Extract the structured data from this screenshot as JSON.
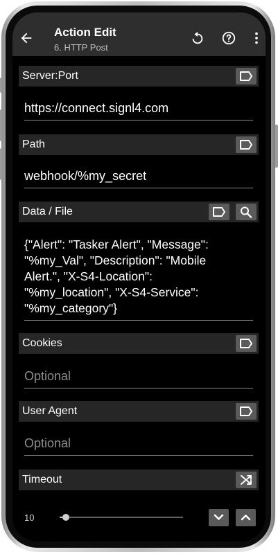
{
  "appbar": {
    "title": "Action Edit",
    "subtitle": "6. HTTP Post",
    "icons": [
      "back-arrow-icon",
      "undo-icon",
      "help-icon",
      "more-vert-icon"
    ]
  },
  "sections": {
    "server_port": {
      "label": "Server:Port",
      "value": "https://connect.signl4.com"
    },
    "path": {
      "label": "Path",
      "value": "webhook/%my_secret"
    },
    "data_file": {
      "label": "Data / File",
      "value": "{\"Alert\": \"Tasker Alert\", \"Message\":\n\"%my_Val\", \"Description\": \"Mobile\nAlert.\", \"X-S4-Location\":\n\"%my_location\", \"X-S4-Service\":\n\"%my_category\"}"
    },
    "cookies": {
      "label": "Cookies",
      "placeholder": "Optional"
    },
    "user_agent": {
      "label": "User Agent",
      "placeholder": "Optional"
    },
    "timeout": {
      "label": "Timeout",
      "value": "10",
      "slider_fraction": 0.05
    }
  },
  "colors": {
    "appbar_bg": "#2e2e2e",
    "screen_bg": "#000000",
    "header_bg": "#262626",
    "button_bg": "#5a5a5a"
  }
}
